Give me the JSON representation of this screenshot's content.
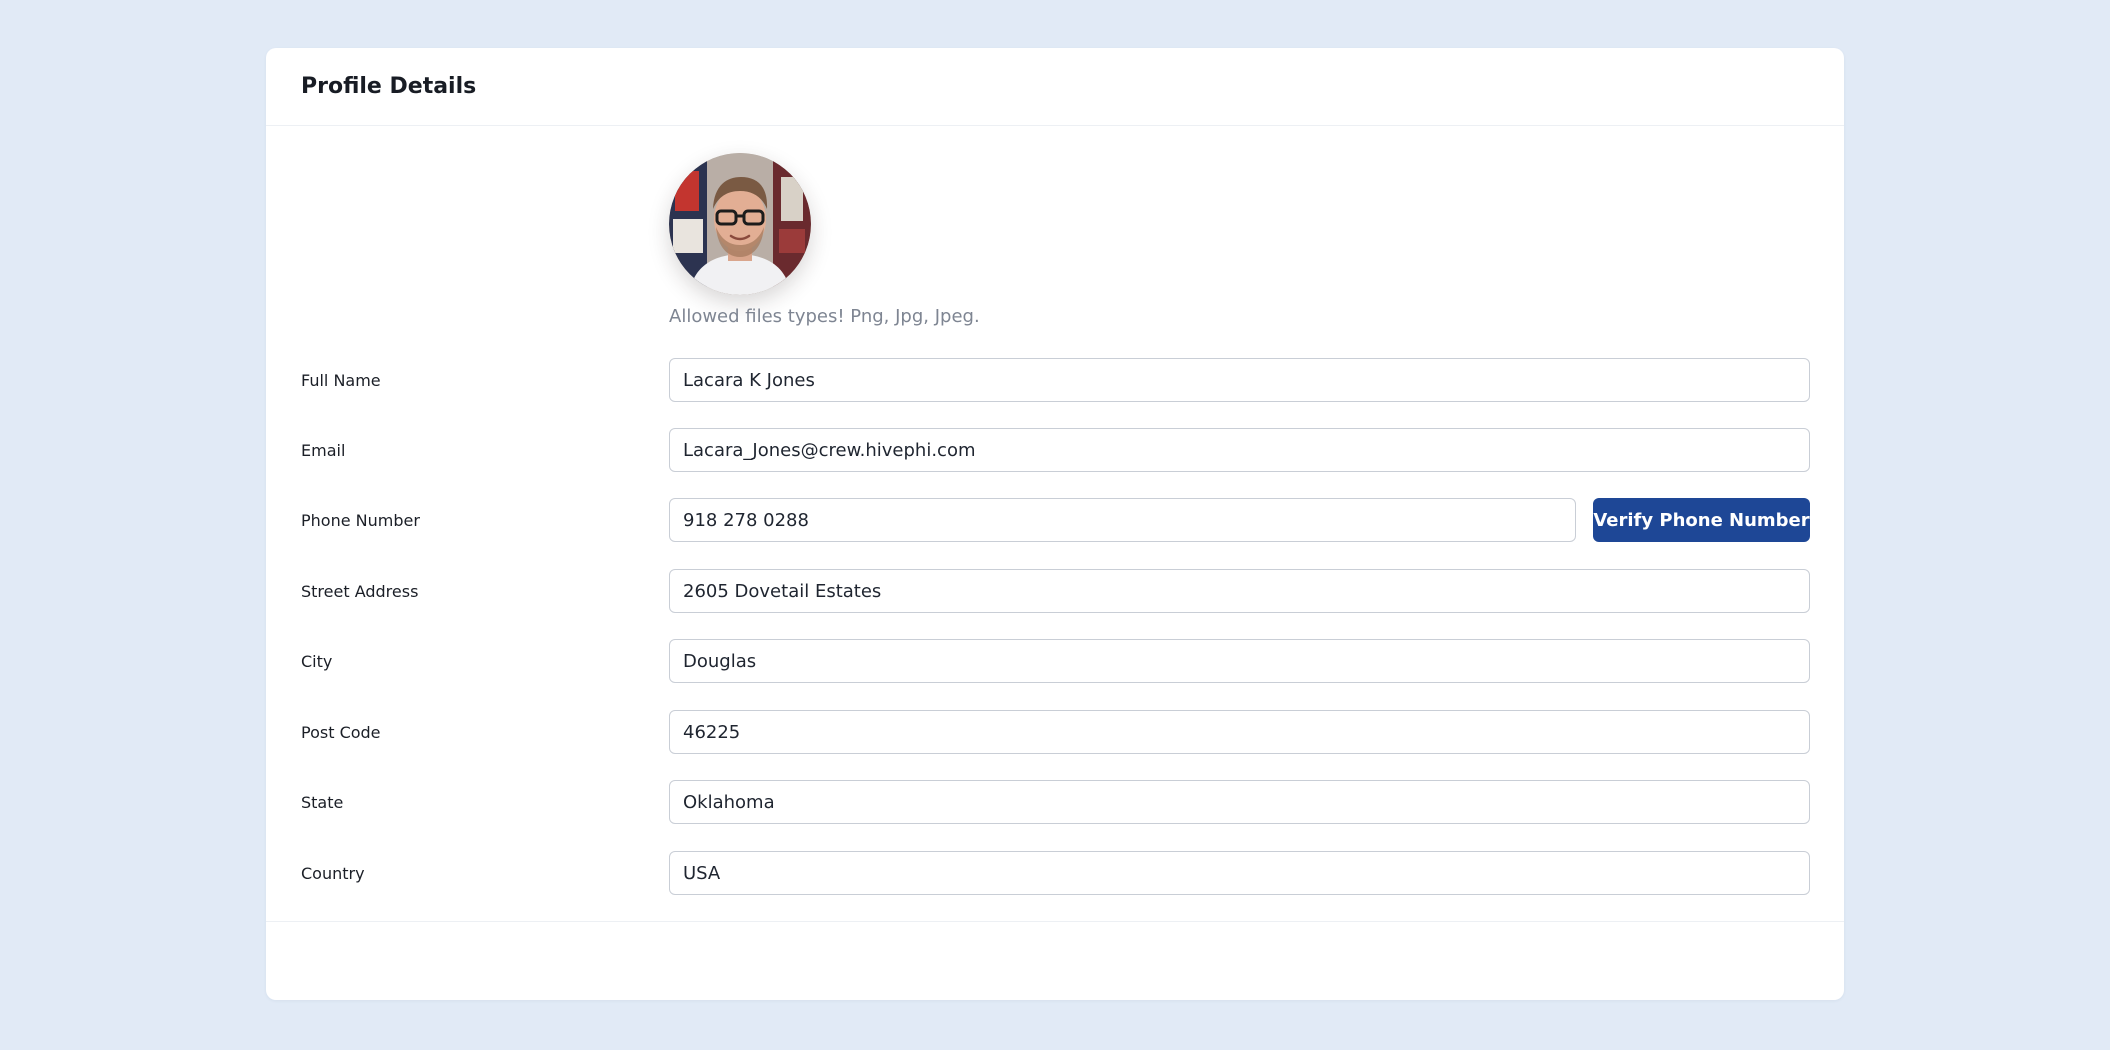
{
  "card": {
    "title": "Profile Details"
  },
  "avatar": {
    "hint": "Allowed files types! Png, Jpg, Jpeg."
  },
  "form": {
    "full_name": {
      "label": "Full Name",
      "value": "Lacara K Jones"
    },
    "email": {
      "label": "Email",
      "value": "Lacara_Jones@crew.hivephi.com"
    },
    "phone": {
      "label": "Phone Number",
      "value": "918 278 0288",
      "button": "Verify Phone Number"
    },
    "street": {
      "label": "Street Address",
      "value": "2605 Dovetail Estates"
    },
    "city": {
      "label": "City",
      "value": "Douglas"
    },
    "post_code": {
      "label": "Post Code",
      "value": "46225"
    },
    "state": {
      "label": "State",
      "value": "Oklahoma"
    },
    "country": {
      "label": "Country",
      "value": "USA"
    }
  },
  "colors": {
    "page_background": "#e1eaf6",
    "card_background": "#ffffff",
    "primary_button": "#1e4796",
    "input_border": "#c9ced6",
    "muted_text": "#7e8592"
  }
}
